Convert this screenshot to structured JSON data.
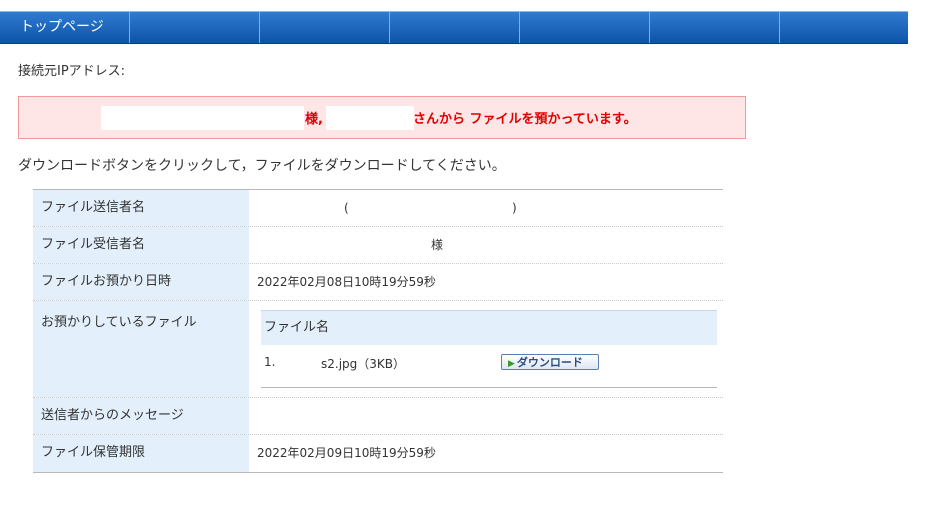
{
  "nav": {
    "tabs": [
      {
        "label": "トップページ"
      },
      {
        "label": ""
      },
      {
        "label": ""
      },
      {
        "label": ""
      },
      {
        "label": ""
      },
      {
        "label": ""
      },
      {
        "label": ""
      }
    ]
  },
  "header": {
    "ip_label": "接続元IPアドレス:"
  },
  "alert": {
    "part1": "様,",
    "part2": "さんから ファイルを預かっています。"
  },
  "instruction": "ダウンロードボタンをクリックして，ファイルをダウンロードしてください。",
  "info": {
    "sender_label": "ファイル送信者名",
    "sender_paren_open": "(",
    "sender_paren_close": ")",
    "recipient_label": "ファイル受信者名",
    "recipient_suffix": "様",
    "deposit_label": "ファイルお預かり日時",
    "deposit_value": "2022年02月08日10時19分59秒",
    "files_label": "お預かりしているファイル",
    "files_header": "ファイル名",
    "files": [
      {
        "num": "1.",
        "name": "s2.jpg（3KB）",
        "button": "ダウンロード"
      }
    ],
    "message_label": "送信者からのメッセージ",
    "message_value": "",
    "expiry_label": "ファイル保管期限",
    "expiry_value": "2022年02月09日10時19分59秒"
  }
}
